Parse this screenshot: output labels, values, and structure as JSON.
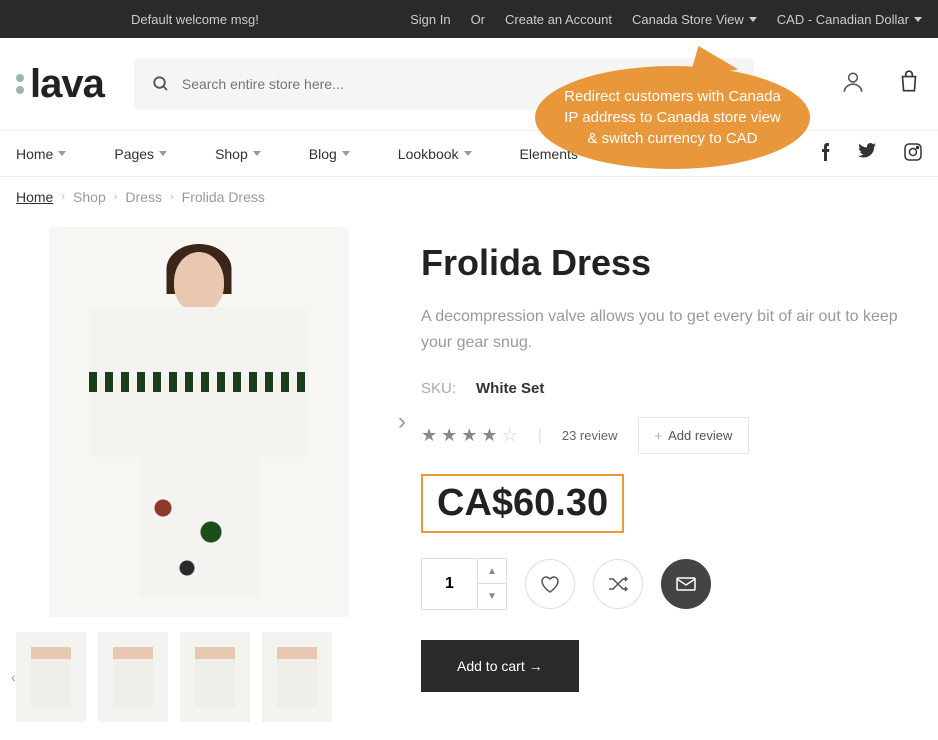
{
  "top_bar": {
    "welcome": "Default welcome msg!",
    "signin": "Sign In",
    "or": "Or",
    "create_account": "Create an Account",
    "store_view": "Canada Store View",
    "currency": "CAD - Canadian Dollar"
  },
  "header": {
    "logo_text": "lava",
    "search_placeholder": "Search entire store here..."
  },
  "nav": {
    "items": [
      {
        "label": "Home"
      },
      {
        "label": "Pages"
      },
      {
        "label": "Shop"
      },
      {
        "label": "Blog"
      },
      {
        "label": "Lookbook"
      },
      {
        "label": "Elements"
      }
    ]
  },
  "breadcrumb": {
    "home": "Home",
    "items": [
      "Shop",
      "Dress",
      "Frolida Dress"
    ]
  },
  "product": {
    "title": "Frolida Dress",
    "description": "A decompression valve allows you to get every bit of air out to keep your gear snug.",
    "sku_label": "SKU:",
    "sku_value": "White Set",
    "review_count": "23 review",
    "add_review": "Add review",
    "price": "CA$60.30",
    "qty": "1",
    "add_to_cart": "Add to cart →"
  },
  "callout": {
    "text": "Redirect customers with Canada IP address to Canada store view & switch currency to CAD"
  }
}
